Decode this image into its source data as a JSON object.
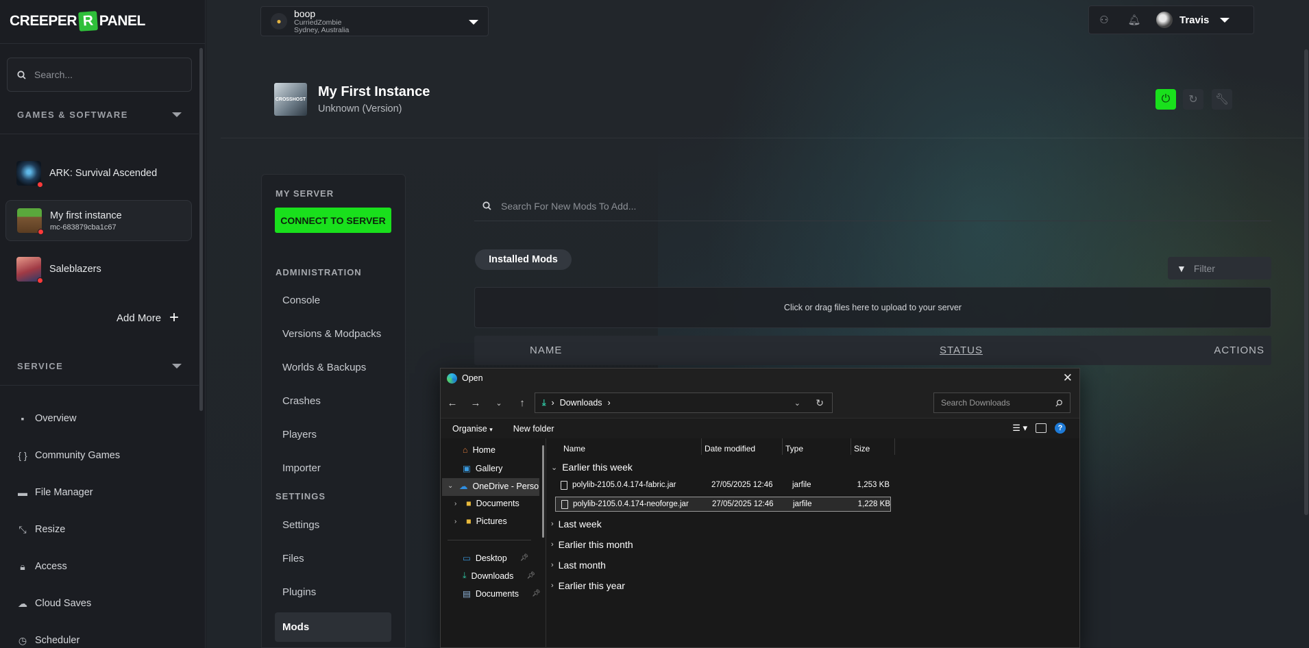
{
  "app": {
    "logo_left": "CREEPER",
    "logo_mid": "R",
    "logo_right": "PANEL"
  },
  "sidebar": {
    "search_placeholder": "Search...",
    "games_heading": "GAMES & SOFTWARE",
    "games": [
      {
        "name": "ARK: Survival Ascended",
        "sub": ""
      },
      {
        "name": "My first instance",
        "sub": "mc-683879cba1c67"
      },
      {
        "name": "Saleblazers",
        "sub": ""
      }
    ],
    "add_more": "Add More",
    "service_heading": "SERVICE",
    "nav": [
      {
        "label": "Overview",
        "icon": "grid-icon"
      },
      {
        "label": "Community Games",
        "icon": "braces-icon"
      },
      {
        "label": "File Manager",
        "icon": "folder-icon"
      },
      {
        "label": "Resize",
        "icon": "resize-icon"
      },
      {
        "label": "Access",
        "icon": "lock-icon"
      },
      {
        "label": "Cloud Saves",
        "icon": "cloud-icon"
      },
      {
        "label": "Scheduler",
        "icon": "clock-icon"
      }
    ]
  },
  "topbar": {
    "server_name": "boop",
    "server_owner": "CurriedZombie",
    "server_location": "Sydney, Australia",
    "user_name": "Travis"
  },
  "instance": {
    "title": "My First Instance",
    "version": "Unknown (Version)",
    "thumb_text": "CROSSHOST"
  },
  "menu": {
    "my_server": "MY SERVER",
    "connect": "CONNECT TO SERVER",
    "administration": "ADMINISTRATION",
    "admin_items": [
      "Console",
      "Versions & Modpacks",
      "Worlds & Backups",
      "Crashes",
      "Players",
      "Importer"
    ],
    "settings": "SETTINGS",
    "settings_items": [
      "Settings",
      "Files",
      "Plugins",
      "Mods"
    ]
  },
  "mods": {
    "search_placeholder": "Search For New Mods To Add...",
    "tab_installed": "Installed Mods",
    "filter_placeholder": "Filter",
    "upload_text": "Click or drag files here to upload to your server",
    "col_name": "NAME",
    "col_status": "STATUS",
    "col_actions": "ACTIONS"
  },
  "dialog": {
    "title": "Open",
    "address": "Downloads",
    "search_placeholder": "Search Downloads",
    "organise": "Organise",
    "new_folder": "New folder",
    "tree": [
      {
        "label": "Home"
      },
      {
        "label": "Gallery"
      },
      {
        "label": "OneDrive - Perso"
      },
      {
        "label": "Documents"
      },
      {
        "label": "Pictures"
      },
      {
        "label": "Desktop"
      },
      {
        "label": "Downloads"
      },
      {
        "label": "Documents"
      }
    ],
    "columns": {
      "name": "Name",
      "date": "Date modified",
      "type": "Type",
      "size": "Size"
    },
    "groups": [
      "Earlier this week",
      "Last week",
      "Earlier this month",
      "Last month",
      "Earlier this year"
    ],
    "files": [
      {
        "name": "polylib-2105.0.4.174-fabric.jar",
        "date": "27/05/2025 12:46",
        "type": "jarfile",
        "size": "1,253 KB"
      },
      {
        "name": "polylib-2105.0.4.174-neoforge.jar",
        "date": "27/05/2025 12:46",
        "type": "jarfile",
        "size": "1,228 KB"
      }
    ]
  },
  "colors": {
    "accent_green": "#19e01c",
    "status_red": "#ff3a3a",
    "dialog_help_blue": "#1e7ad6"
  }
}
